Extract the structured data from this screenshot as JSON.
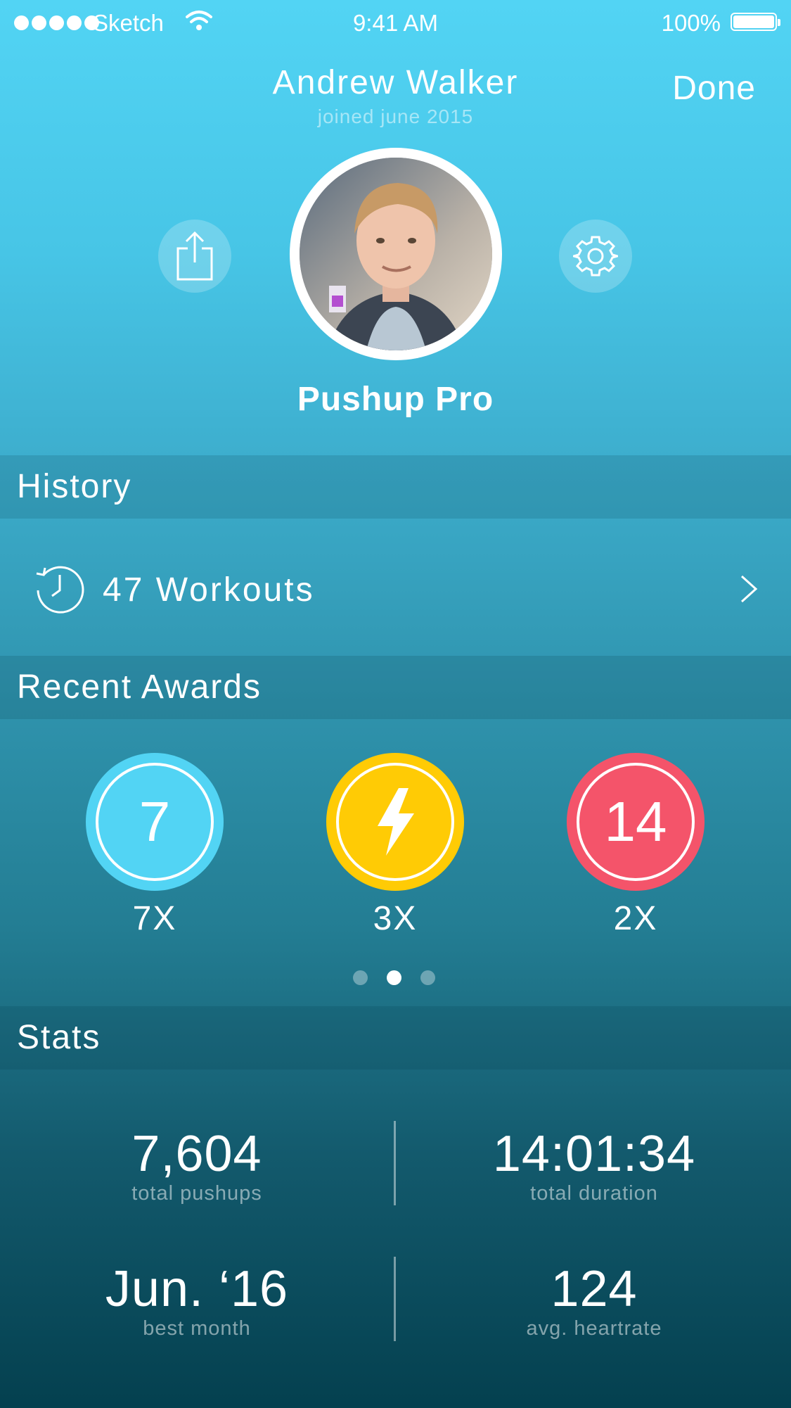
{
  "status_bar": {
    "carrier": "Sketch",
    "time": "9:41 AM",
    "battery": "100%",
    "battery_level": 1.0,
    "signal_bars": 5
  },
  "header": {
    "name": "Andrew Walker",
    "joined": "joined june 2015",
    "done_label": "Done"
  },
  "profile": {
    "rank": "Pushup Pro",
    "share_icon": "share-icon",
    "settings_icon": "gear-icon"
  },
  "history": {
    "title": "History",
    "workouts_label": "47 Workouts",
    "icon": "history-clock-icon"
  },
  "awards": {
    "title": "Recent Awards",
    "items": [
      {
        "badge": "7",
        "count": "7X",
        "color": "#52d4f4"
      },
      {
        "badge": "lightning-icon",
        "count": "3X",
        "color": "#ffcb05"
      },
      {
        "badge": "14",
        "count": "2X",
        "color": "#f4546a"
      }
    ],
    "page_count": 3,
    "active_page": 2
  },
  "stats": {
    "title": "Stats",
    "items": [
      {
        "value": "7,604",
        "label": "total pushups"
      },
      {
        "value": "14:01:34",
        "label": "total duration"
      },
      {
        "value": "Jun. ‘16",
        "label": "best month"
      },
      {
        "value": "124",
        "label": "avg. heartrate"
      }
    ]
  },
  "colors": {
    "accent_blue": "#52d4f4",
    "accent_yellow": "#ffcb05",
    "accent_red": "#f4546a"
  }
}
